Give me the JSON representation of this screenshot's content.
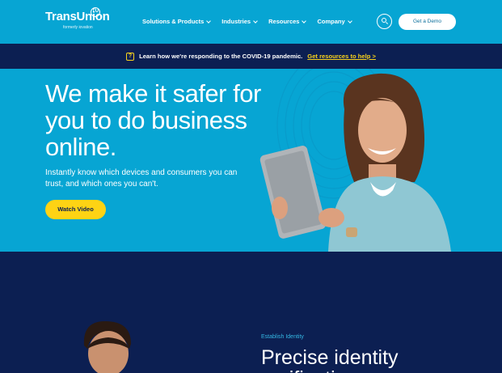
{
  "header": {
    "logo_text": "TransUnion",
    "logo_badge": "TU",
    "logo_subtext": "formerly iovation",
    "nav": [
      {
        "label": "Solutions & Products"
      },
      {
        "label": "Industries"
      },
      {
        "label": "Resources"
      },
      {
        "label": "Company"
      }
    ],
    "demo_label": "Get a Demo"
  },
  "banner": {
    "icon": "alert-icon",
    "icon_glyph": "?",
    "text": "Learn how we're responding to the COVID-19 pandemic.",
    "link": "Get resources to help >"
  },
  "hero": {
    "title": "We make it safer for you to do business online.",
    "subtitle": "Instantly know which devices and consumers you can trust, and which ones you can't.",
    "button": "Watch Video"
  },
  "section": {
    "eyebrow": "Establish Identity",
    "title_line1": "Precise identity",
    "title_line2": "verification"
  },
  "colors": {
    "primary": "#07a5d3",
    "navy": "#0c1f52",
    "accent_yellow": "#fed314",
    "eyebrow_blue": "#35b7e3"
  }
}
